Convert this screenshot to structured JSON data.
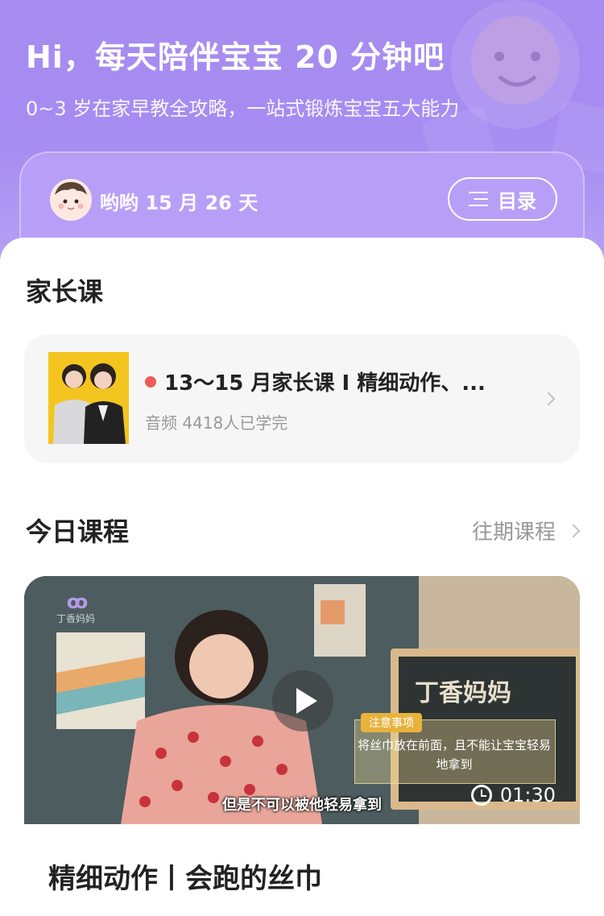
{
  "hero": {
    "title": "Hi，每天陪伴宝宝 20 分钟吧",
    "subtitle": "0~3 岁在家早教全攻略，一站式锻炼宝宝五大能力"
  },
  "profile": {
    "baby_name": "哟哟 15 月 26 天",
    "catalog_label": "目录"
  },
  "parent_course": {
    "section_title": "家长课",
    "title": "13～15 月家长课 I 精细动作、...",
    "meta": "音频 4418人已学完"
  },
  "today": {
    "section_title": "今日课程",
    "past_label": "往期课程",
    "video": {
      "duration": "01:30",
      "caption": "但是不可以被他轻易拿到",
      "board_title": "丁香妈妈",
      "note_label": "注意事项",
      "note_text": "将丝巾放在前面，且不能让宝宝轻易地拿到",
      "brand_name": "丁香妈妈"
    },
    "course_title": "精细动作丨会跑的丝巾"
  },
  "colors": {
    "hero_purple": "#a78bf0",
    "red_dot": "#f05a5a",
    "muted_text": "#999999"
  }
}
